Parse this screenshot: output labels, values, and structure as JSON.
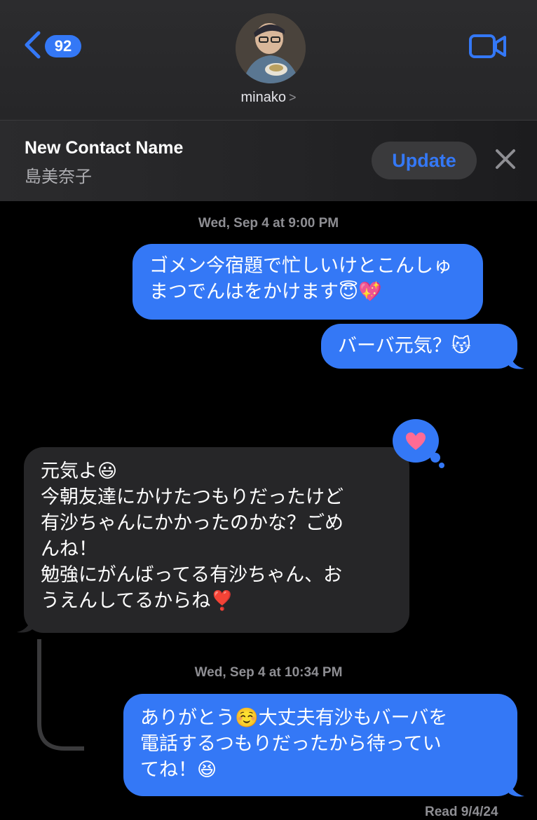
{
  "header": {
    "unread_count": "92",
    "contact_name": "minako",
    "chevron": ">"
  },
  "banner": {
    "title": "New Contact Name",
    "subtitle": "島美奈子",
    "update_label": "Update"
  },
  "messages": [
    {
      "timestamp": "Wed, Sep 4 at 9:00 PM"
    },
    {
      "text": "ゴメン今宿題で忙しいけとこんしゅ\nまつでんはをかけます😇💖"
    },
    {
      "text": "バーバ元気？😽"
    },
    {
      "text": "元気よ😃\n今朝友達にかけたつもりだったけど\n有沙ちゃんにかかったのかな？ごめ\nんね！\n勉強にがんばってる有沙ちゃん、お\nうえんしてるからね❣️"
    },
    {
      "timestamp": "Wed, Sep 4 at 10:34 PM"
    },
    {
      "text": "ありがとう☺️大丈夫有沙もバーバを\n電話するつもりだったから待ってい\nてね！😆"
    }
  ],
  "reaction": {
    "icon": "heart-icon",
    "color": "#3478f6"
  },
  "read_receipt": "Read 9/4/24",
  "colors": {
    "accent": "#3478f6",
    "incoming": "#262628"
  }
}
